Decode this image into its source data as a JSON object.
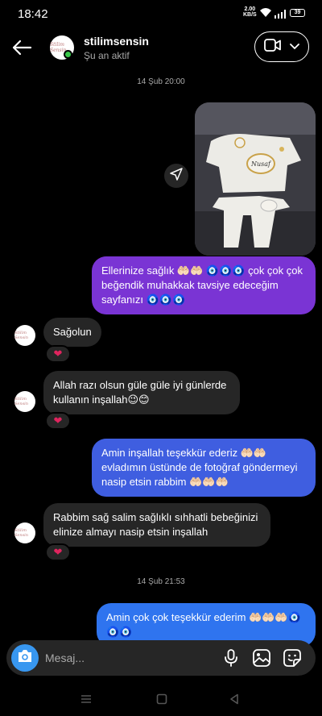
{
  "status_bar": {
    "time": "18:42",
    "net_speed": "2.00",
    "net_unit": "KB/S",
    "battery": "39",
    "icons": [
      "wifi-icon",
      "signal-icon",
      "battery-icon"
    ]
  },
  "header": {
    "name": "stilimsensin",
    "status": "Şu an aktif",
    "avatar_text": "Stilim Sensin",
    "icons": [
      "back-arrow-icon",
      "video-call-icon",
      "chevron-down-icon"
    ]
  },
  "messages": [
    {
      "type": "timestamp",
      "text": "14 Şub 20:00"
    },
    {
      "type": "photo",
      "sender": "me",
      "caption_on_photo": "Nusaf"
    },
    {
      "type": "text",
      "sender": "me",
      "text": "Ellerinize sağlık 🤲🏻🤲🏻 🧿🧿🧿 çok çok çok beğendik  muhakkak tavsiye edeceğim sayfanızı 🧿🧿🧿"
    },
    {
      "type": "text",
      "sender": "them",
      "text": "Sağolun",
      "reaction": "❤"
    },
    {
      "type": "text",
      "sender": "them",
      "text": "Allah razı olsun güle güle iyi günlerde kullanın inşallah😉😊",
      "reaction": "❤"
    },
    {
      "type": "text",
      "sender": "me",
      "text": "Amin inşallah teşekkür ederiz 🤲🏻🤲🏻 evladımın üstünde de fotoğraf göndermeyi nasip etsin rabbim 🤲🏻🤲🏻🤲🏻"
    },
    {
      "type": "text",
      "sender": "them",
      "text": "Rabbim sağ salim sağlıklı sıhhatli bebeğinizi elinize almayı nasip etsin inşallah",
      "reaction": "❤"
    },
    {
      "type": "timestamp",
      "text": "14 Şub 21:53"
    },
    {
      "type": "text",
      "sender": "me",
      "text": "Amin çok çok teşekkür ederim 🤲🏻🤲🏻🤲🏻🧿🧿🧿"
    }
  ],
  "composer": {
    "placeholder": "Mesaj...",
    "icons": [
      "camera-icon",
      "microphone-icon",
      "gallery-icon",
      "sticker-icon"
    ]
  },
  "colors": {
    "background": "#000000",
    "incoming_bubble": "#262626",
    "outgoing_bubble_purple": "#7a34d4",
    "outgoing_bubble_indigo": "#3f5ee0",
    "outgoing_bubble_blue": "#2f74ef",
    "online": "#3ac74a",
    "accent": "#3897f0"
  }
}
